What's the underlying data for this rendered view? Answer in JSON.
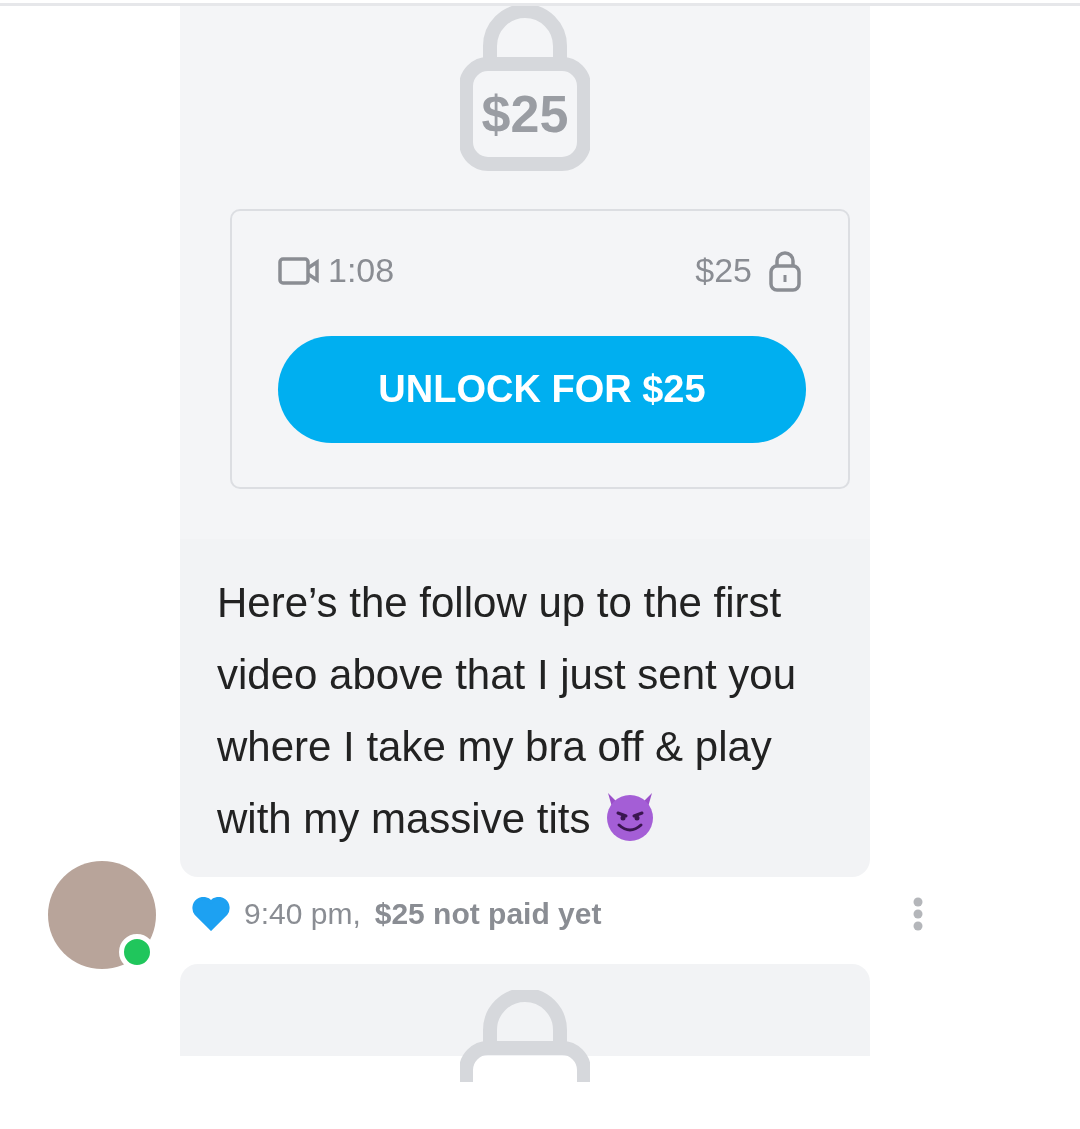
{
  "messages": [
    {
      "locked": true,
      "lock_price": "$25",
      "media": {
        "duration": "1:08",
        "price": "$25"
      },
      "unlock_button": "UNLOCK FOR $25",
      "text": "Here’s the follow up to the first video above that I just sent you where I take my bra off & play with my massive tits",
      "sender": {
        "online": true
      },
      "liked": true,
      "time": "9:40 pm,",
      "payment_status": "$25 not paid yet"
    },
    {
      "locked": true
    }
  ]
}
